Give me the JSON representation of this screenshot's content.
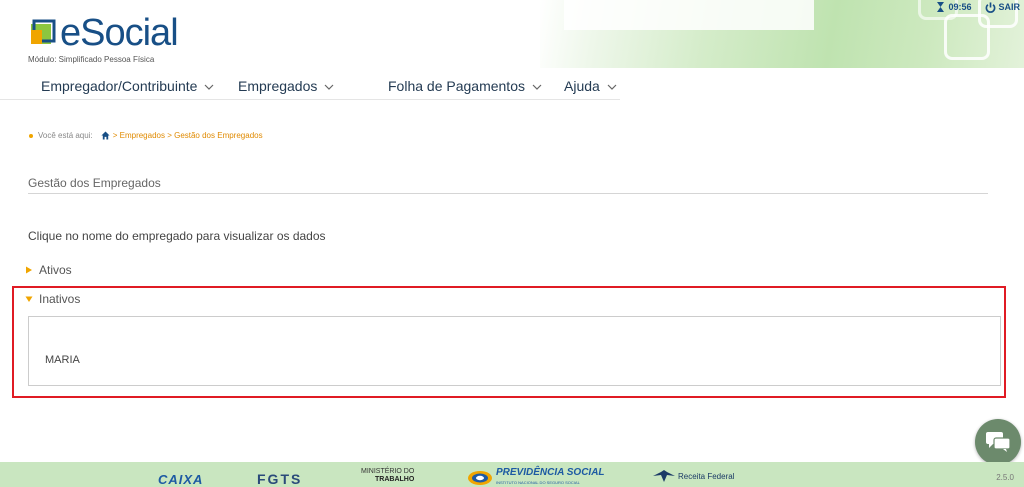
{
  "header": {
    "logo_text": "eSocial",
    "subtitle": "Módulo: Simplificado Pessoa Física",
    "time": "09:56",
    "logout_label": "SAIR"
  },
  "nav": {
    "items": [
      {
        "label": "Empregador/Contribuinte"
      },
      {
        "label": "Empregados"
      },
      {
        "label": "Folha de Pagamentos"
      },
      {
        "label": "Ajuda"
      }
    ]
  },
  "breadcrumb": {
    "prefix": "Você está aqui:",
    "trail": "> Empregados > Gestão dos Empregados"
  },
  "main": {
    "page_title": "Gestão dos Empregados",
    "instruction": "Clique no nome do empregado para visualizar os dados",
    "groups": [
      {
        "label": "Ativos",
        "state": "collapsed"
      },
      {
        "label": "Inativos",
        "state": "expanded",
        "employees": [
          {
            "name": "MARIA"
          }
        ]
      }
    ]
  },
  "footer": {
    "logos": {
      "caixa": "CAIXA",
      "fgts": "FGTS",
      "ministerio_line1": "MINISTÉRIO DO",
      "ministerio_line2": "TRABALHO",
      "previdencia": "PREVIDÊNCIA SOCIAL",
      "previdencia_sub": "INSTITUTO NACIONAL DO SEGURO SOCIAL",
      "receita": "Receita Federal"
    },
    "version": "2.5.0"
  },
  "colors": {
    "brand_blue": "#184f86",
    "accent_orange": "#f0a500",
    "highlight_red": "#e01b24",
    "footer_green": "#c9e6c0",
    "chat_green": "#6c8a6c"
  },
  "icons": [
    "esocial-logo-icon",
    "clock-icon",
    "power-icon",
    "chevron-down-icon",
    "home-icon",
    "triangle-right-icon",
    "triangle-down-icon",
    "chat-icon"
  ]
}
